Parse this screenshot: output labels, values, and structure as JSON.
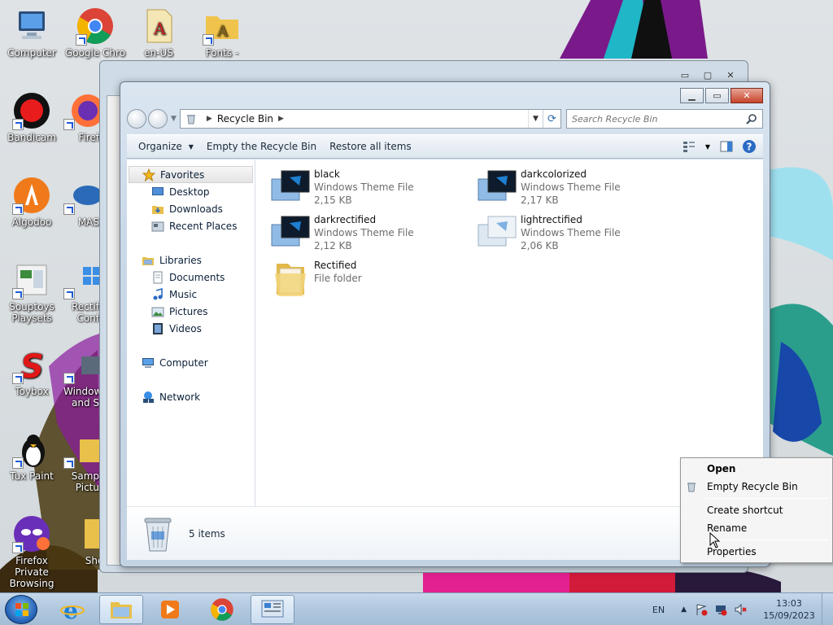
{
  "desktop": {
    "icons": [
      {
        "label": "Computer"
      },
      {
        "label": "Google Chro"
      },
      {
        "label": "en-US"
      },
      {
        "label": "Fonts -"
      },
      {
        "label": "Bandicam"
      },
      {
        "label": "Firef"
      },
      {
        "label": "Algodoo"
      },
      {
        "label": "MAS"
      },
      {
        "label": "Souptoys Playsets"
      },
      {
        "label": "Rectif Conf"
      },
      {
        "label": "Toybox"
      },
      {
        "label": "Window and S"
      },
      {
        "label": "Tux Paint"
      },
      {
        "label": "Samp Pictu"
      },
      {
        "label": "Firefox Private Browsing"
      },
      {
        "label": "Shell"
      }
    ]
  },
  "window": {
    "address": {
      "location": "Recycle Bin"
    },
    "search_placeholder": "Search Recycle Bin",
    "toolbar": {
      "organize": "Organize",
      "empty": "Empty the Recycle Bin",
      "restore": "Restore all items"
    },
    "nav": {
      "favorites": "Favorites",
      "desktop": "Desktop",
      "downloads": "Downloads",
      "recent": "Recent Places",
      "libraries": "Libraries",
      "documents": "Documents",
      "music": "Music",
      "pictures": "Pictures",
      "videos": "Videos",
      "computer": "Computer",
      "network": "Network"
    },
    "files": [
      {
        "name": "black",
        "type": "Windows Theme File",
        "size": "2,15 KB"
      },
      {
        "name": "darkcolorized",
        "type": "Windows Theme File",
        "size": "2,17 KB"
      },
      {
        "name": "darkrectified",
        "type": "Windows Theme File",
        "size": "2,12 KB"
      },
      {
        "name": "lightrectified",
        "type": "Windows Theme File",
        "size": "2,06 KB"
      },
      {
        "name": "Rectified",
        "type": "File folder",
        "size": ""
      }
    ],
    "details": {
      "count": "5 items"
    }
  },
  "context_menu": {
    "open": "Open",
    "empty": "Empty Recycle Bin",
    "create_shortcut": "Create shortcut",
    "rename": "Rename",
    "properties": "Properties"
  },
  "taskbar": {
    "lang": "EN",
    "time": "13:03",
    "date": "15/09/2023"
  },
  "colors": {
    "accent": "#1e5fb3",
    "close_button": "#c7432a",
    "theme_icon": "#1f7fd0"
  }
}
